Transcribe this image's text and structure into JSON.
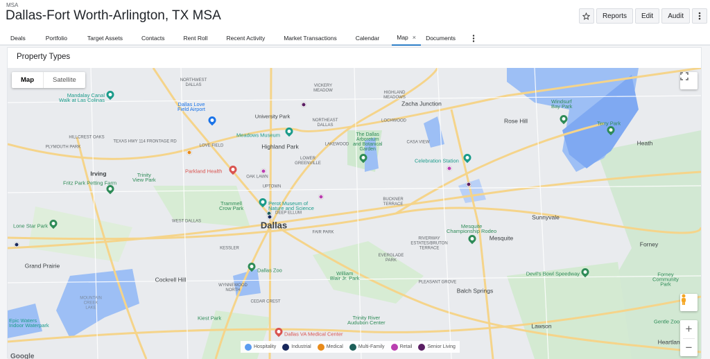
{
  "header": {
    "supertitle": "MSA",
    "title": "Dallas-Fort Worth-Arlington, TX MSA",
    "actions": {
      "reports": "Reports",
      "edit": "Edit",
      "audit": "Audit",
      "star_icon": "star-icon",
      "more_icon": "more-vertical-icon"
    }
  },
  "tabs": [
    {
      "label": "Deals"
    },
    {
      "label": "Portfolio"
    },
    {
      "label": "Target Assets"
    },
    {
      "label": "Contacts"
    },
    {
      "label": "Rent Roll"
    },
    {
      "label": "Recent Activity"
    },
    {
      "label": "Market Transactions"
    },
    {
      "label": "Calendar"
    },
    {
      "label": "Map",
      "active": true,
      "close": "×"
    },
    {
      "label": "Documents"
    }
  ],
  "card": {
    "title": "Property Types"
  },
  "map": {
    "maptype": {
      "map": "Map",
      "satellite": "Satellite"
    },
    "zoom": {
      "in": "+",
      "out": "−"
    },
    "google": "Google",
    "legend": [
      {
        "label": "Hospitality",
        "color": "#5b9cf0"
      },
      {
        "label": "Industrial",
        "color": "#17275c"
      },
      {
        "label": "Medical",
        "color": "#e88a1a"
      },
      {
        "label": "Multi-Family",
        "color": "#1e5f5a"
      },
      {
        "label": "Retail",
        "color": "#b93fb0"
      },
      {
        "label": "Senior Living",
        "color": "#5a1e63"
      }
    ],
    "labels": {
      "dallas": "Dallas",
      "irving": "Irving",
      "grand_prairie": "Grand Prairie",
      "cockrell_hill": "Cockrell Hill",
      "highland_park": "Highland Park",
      "university_park": "University Park",
      "mesquite": "Mesquite",
      "sunnyvale": "Sunnyvale",
      "rose_hill": "Rose Hill",
      "heath": "Heath",
      "forney": "Forney",
      "balch_springs": "Balch Springs",
      "lawson": "Lawson",
      "heartland": "Heartland",
      "zacha_junction": "Zacha Junction",
      "mandalay": "Mandalay Canal\nWalk at Las Colinas",
      "love_field": "Dallas Love\nField Airport",
      "meadows": "Meadows Museum",
      "arboretum": "The Dallas\nArboretum\nand Botanical\nGarden",
      "celebration": "Celebration Station",
      "windsurf": "Windsurf\nBay Park",
      "terry": "Terry Park",
      "parkland": "Parkland Health",
      "fritz": "Fritz Park Petting Farm",
      "trinity_view": "Trinity\nView Park",
      "trammell": "Trammell\nCrow Park",
      "perot": "Perot Museum of\nNature and Science",
      "lone_star": "Lone Star Park",
      "dallas_zoo": "Dallas Zoo",
      "william_blair": "William\nBlair Jr. Park",
      "mesquite_rodeo": "Mesquite\nChampionship Rodeo",
      "devils_bowl": "Devil's Bowl Speedway",
      "forney_park": "Forney\nCommunity\nPark",
      "mountain_creek": "MOUNTAIN\nCREEK\nLAKE",
      "kiest": "Kiest Park",
      "epic_waters": "Epic Waters\nIndoor Waterpark",
      "va_medical": "Dallas VA Medical Center",
      "trinity_river": "Trinity River\nAudubon Center",
      "gentle_zoo": "Gentle Zoo",
      "northwest_dallas": "NORTHWEST\nDALLAS",
      "vickery": "VICKERY\nMEADOW",
      "highland_meadows": "HIGHLAND\nMEADOWS",
      "lochwood": "LOCHWOOD",
      "northeast_dallas": "NORTHEAST\nDALLAS",
      "lakewood": "LAKEWOOD",
      "casa_view": "CASA VIEW",
      "lower_greenville": "LOWER\nGREENVILLE",
      "oak_lawn": "OAK LAWN",
      "uptown": "UPTOWN",
      "deep_ellum": "DEEP ELLUM",
      "love_field_nb": "LOVE FIELD",
      "west_dallas": "WEST DALLAS",
      "kessler": "KESSLER",
      "buckner": "BUCKNER\nTERRACE",
      "everglade": "EVERGLADE\nPARK",
      "riverway": "RIVERWAY\nESTATES/BRUTON\nTERRACE",
      "pleasant_grove": "PLEASANT GROVE",
      "cedar_crest": "CEDAR CREST",
      "wynnewood": "WYNNEWOOD\nNORTH",
      "fair_park": "FAIR PARK",
      "plymouth": "PLYMOUTH PARK",
      "hillcrest": "HILLCREST OAKS",
      "texas_hwy": "Texas Hwy 114 Frontage Rd"
    }
  }
}
